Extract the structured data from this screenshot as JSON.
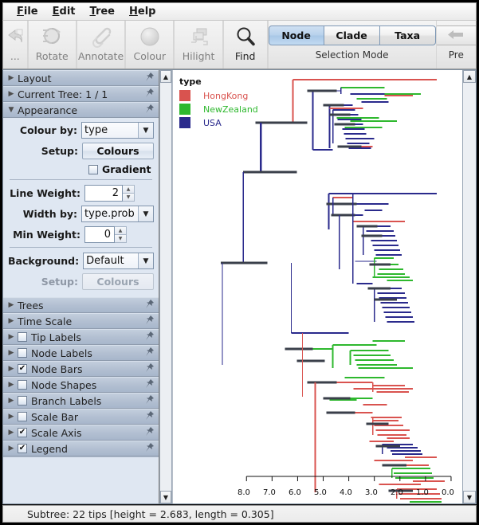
{
  "menubar": {
    "items": [
      "File",
      "Edit",
      "Tree",
      "Help"
    ]
  },
  "toolbar": {
    "buttons": [
      {
        "label": "...",
        "icon": "undo-icon",
        "enabled": false
      },
      {
        "label": "Rotate",
        "icon": "rotate-icon",
        "enabled": false
      },
      {
        "label": "Annotate",
        "icon": "annotate-icon",
        "enabled": false
      },
      {
        "label": "Colour",
        "icon": "colour-icon",
        "enabled": false
      },
      {
        "label": "Hilight",
        "icon": "hilight-icon",
        "enabled": false
      },
      {
        "label": "Find",
        "icon": "search-icon",
        "enabled": true
      }
    ],
    "selection_mode": {
      "caption": "Selection Mode",
      "options": [
        "Node",
        "Clade",
        "Taxa"
      ],
      "selected": "Node"
    },
    "previous_group": {
      "caption": "Pre",
      "icon": "left-arrow-icon"
    }
  },
  "sidebar": {
    "panels": [
      {
        "name": "layout",
        "label": "Layout",
        "expanded": false,
        "checkbox": null,
        "pin": "pin-icon"
      },
      {
        "name": "current-tree",
        "label": "Current Tree: 1 / 1",
        "expanded": false,
        "checkbox": null,
        "pin": "pin-icon"
      },
      {
        "name": "appearance",
        "label": "Appearance",
        "expanded": true,
        "checkbox": null,
        "pin": "pin-icon"
      }
    ],
    "appearance": {
      "colour_by_label": "Colour by:",
      "colour_by_value": "type",
      "setup_label_1": "Setup:",
      "setup_button_1": "Colours",
      "gradient_label": "Gradient",
      "gradient_checked": false,
      "line_weight_label": "Line Weight:",
      "line_weight_value": "2",
      "width_by_label": "Width by:",
      "width_by_value": "type.prob",
      "min_weight_label": "Min Weight:",
      "min_weight_value": "0",
      "background_label": "Background:",
      "background_value": "Default",
      "setup_label_2": "Setup:",
      "setup_button_2": "Colours",
      "setup_button_2_enabled": false
    },
    "lower_panels": [
      {
        "name": "trees",
        "label": "Trees",
        "checkbox": null,
        "pin": "pin-icon"
      },
      {
        "name": "time-scale",
        "label": "Time Scale",
        "checkbox": null,
        "pin": "pin-icon"
      },
      {
        "name": "tip-labels",
        "label": "Tip Labels",
        "checkbox": false,
        "pin": "pin-icon"
      },
      {
        "name": "node-labels",
        "label": "Node Labels",
        "checkbox": false,
        "pin": "pin-icon"
      },
      {
        "name": "node-bars",
        "label": "Node Bars",
        "checkbox": true,
        "pin": "pin-icon"
      },
      {
        "name": "node-shapes",
        "label": "Node Shapes",
        "checkbox": false,
        "pin": "pin-icon"
      },
      {
        "name": "branch-labels",
        "label": "Branch Labels",
        "checkbox": false,
        "pin": "pin-icon"
      },
      {
        "name": "scale-bar",
        "label": "Scale Bar",
        "checkbox": false,
        "pin": "pin-icon"
      },
      {
        "name": "scale-axis",
        "label": "Scale Axis",
        "checkbox": true,
        "pin": "pin-icon"
      },
      {
        "name": "legend",
        "label": "Legend",
        "checkbox": true,
        "pin": "pin-icon"
      }
    ],
    "scrollbar": {
      "up": "scroll-up-icon",
      "down": "scroll-down-icon"
    }
  },
  "tree_view": {
    "legend": {
      "title": "type",
      "entries": [
        {
          "label": "HongKong",
          "colour": "#d9534f"
        },
        {
          "label": "NewZealand",
          "colour": "#2eb82e"
        },
        {
          "label": "USA",
          "colour": "#2a2a8c"
        }
      ]
    },
    "scale_axis": {
      "ticks": [
        "8.0",
        "7.0",
        "6.0",
        "5.0",
        "4.0",
        "3.0",
        "2.0",
        "1.0",
        "0.0"
      ],
      "values": [
        8.0,
        7.0,
        6.0,
        5.0,
        4.0,
        3.0,
        2.0,
        1.0,
        0.0
      ]
    },
    "scrollbar": {
      "up": "scroll-up-icon",
      "down": "scroll-down-icon"
    }
  },
  "statusbar": {
    "text": "Subtree: 22 tips [height = 2.683, length = 0.305]"
  },
  "colours": {
    "hongkong": "#d9534f",
    "newzealand": "#2eb82e",
    "usa": "#2a2a8c",
    "node_bar": "#3a3f4a",
    "selection_accent": "#a8c7e6"
  }
}
